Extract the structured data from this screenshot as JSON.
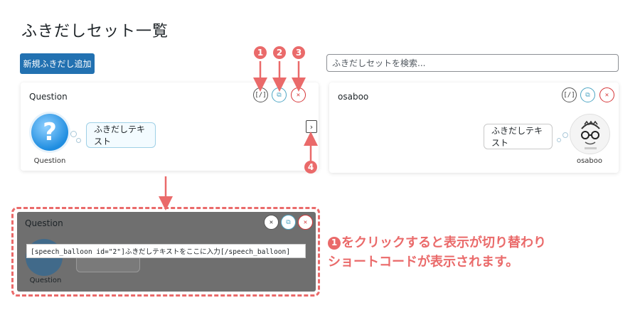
{
  "page": {
    "title": "ふきだしセット一覧"
  },
  "toolbar": {
    "add_label": "新規ふきだし追加",
    "search_placeholder": "ふきだしセットを検索..."
  },
  "cards": [
    {
      "title": "Question",
      "avatar_label": "Question",
      "balloon_text": "ふきだしテキスト",
      "buttons": [
        "code",
        "copy",
        "delete"
      ]
    },
    {
      "title": "osaboo",
      "avatar_label": "osaboo",
      "balloon_text": "ふきだしテキスト",
      "buttons": [
        "code",
        "copy",
        "delete"
      ]
    }
  ],
  "shortcode_panel": {
    "title": "Question",
    "avatar_label": "Question",
    "shortcode": "[speech_balloon id=\"2\"]ふきだしテキストをここに入力[/speech_balloon]"
  },
  "annotations": {
    "markers": [
      "1",
      "2",
      "3",
      "4"
    ],
    "explanation_line1": "をクリックすると表示が切り替わり",
    "explanation_line2": "ショートコードが表示されます。"
  },
  "colors": {
    "accent": "#2271b1",
    "annotation": "#ea6a6a",
    "copy_icon": "#4fa6c4",
    "delete_icon": "#d63638"
  }
}
